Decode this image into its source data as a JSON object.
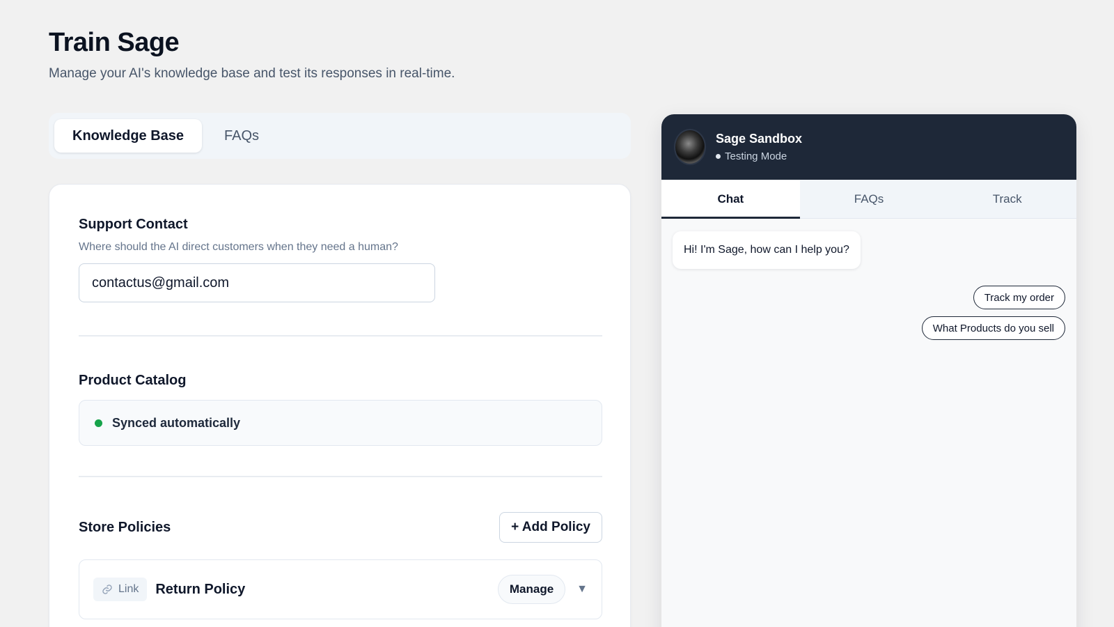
{
  "page": {
    "title": "Train Sage",
    "subtitle": "Manage your AI's knowledge base and test its responses in real-time."
  },
  "tabs": [
    {
      "label": "Knowledge Base",
      "active": true
    },
    {
      "label": "FAQs",
      "active": false
    }
  ],
  "support_contact": {
    "title": "Support Contact",
    "description": "Where should the AI direct customers when they need a human?",
    "email_value": "contactus@gmail.com"
  },
  "product_catalog": {
    "title": "Product Catalog",
    "status": "Synced automatically",
    "status_color": "#16a34a"
  },
  "store_policies": {
    "title": "Store Policies",
    "add_label": "+ Add Policy",
    "items": [
      {
        "type_label": "Link",
        "type_icon": "link-icon",
        "name": "Return Policy",
        "manage_label": "Manage",
        "toggle_icon": "chevron-down-icon"
      }
    ]
  },
  "chat": {
    "name": "Sage Sandbox",
    "status": "Testing Mode",
    "header_color": "#1e2838",
    "tabs": [
      {
        "label": "Chat",
        "active": true
      },
      {
        "label": "FAQs",
        "active": false
      },
      {
        "label": "Track",
        "active": false
      }
    ],
    "greeting": "Hi! I'm Sage, how can I help you?",
    "quick_replies": [
      "Track my order",
      "What Products do you sell"
    ]
  }
}
